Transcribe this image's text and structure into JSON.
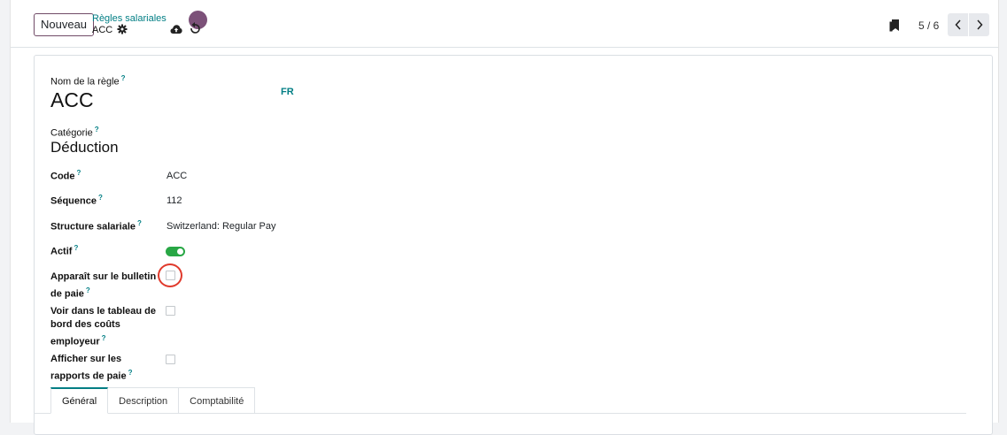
{
  "control_panel": {
    "new_button": "Nouveau",
    "breadcrumb_parent": "Règles salariales",
    "breadcrumb_current": "ACC",
    "pager": "5 / 6"
  },
  "form": {
    "name_label": "Nom de la règle",
    "name_value": "ACC",
    "lang_button": "FR",
    "category_label": "Catégorie",
    "category_value": "Déduction",
    "help_mark": "?",
    "fields": {
      "code": {
        "label": "Code",
        "value": "ACC"
      },
      "sequence": {
        "label": "Séquence",
        "value": "112"
      },
      "structure": {
        "label": "Structure salariale",
        "value": "Switzerland: Regular Pay"
      },
      "active": {
        "label": "Actif",
        "checked": true
      },
      "appears_on_payslip": {
        "label_line1": "Apparaît sur le bulletin",
        "label_line2": "de paie",
        "checked": false
      },
      "employer_cost": {
        "label_line1": "Voir dans le tableau de",
        "label_line2": "bord des coûts",
        "label_line3": "employeur",
        "checked": false
      },
      "payroll_reports": {
        "label_line1": "Afficher sur les",
        "label_line2": "rapports de paie",
        "checked": false
      }
    }
  },
  "tabs": [
    {
      "label": "Général",
      "active": true
    },
    {
      "label": "Description",
      "active": false
    },
    {
      "label": "Comptabilité",
      "active": false
    }
  ],
  "colors": {
    "accent": "#017e84",
    "brand": "#714b67",
    "toggle_on": "#28a745",
    "annotation": "#e03a2c"
  }
}
